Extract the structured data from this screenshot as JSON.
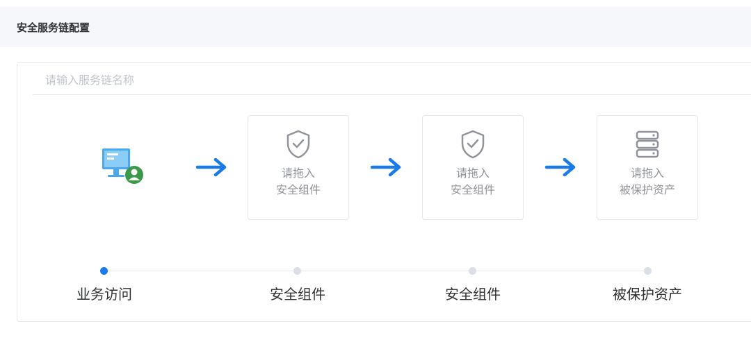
{
  "header": {
    "title": "安全服务链配置"
  },
  "chain_name": {
    "placeholder": "请输入服务链名称",
    "value": ""
  },
  "source_node": {
    "icon": "computer-user-icon"
  },
  "drop_slots": [
    {
      "line1": "请拖入",
      "line2": "安全组件",
      "icon": "shield-check-icon"
    },
    {
      "line1": "请拖入",
      "line2": "安全组件",
      "icon": "shield-check-icon"
    },
    {
      "line1": "请拖入",
      "line2": "被保护资产",
      "icon": "server-icon"
    }
  ],
  "steps": [
    {
      "label": "业务访问",
      "active": true
    },
    {
      "label": "安全组件",
      "active": false
    },
    {
      "label": "安全组件",
      "active": false
    },
    {
      "label": "被保护资产",
      "active": false
    }
  ],
  "colors": {
    "accent": "#1a7ae8",
    "inactive_dot": "#dcdfe6",
    "user_badge": "#3a9a4a",
    "icon_gray": "#909399"
  }
}
